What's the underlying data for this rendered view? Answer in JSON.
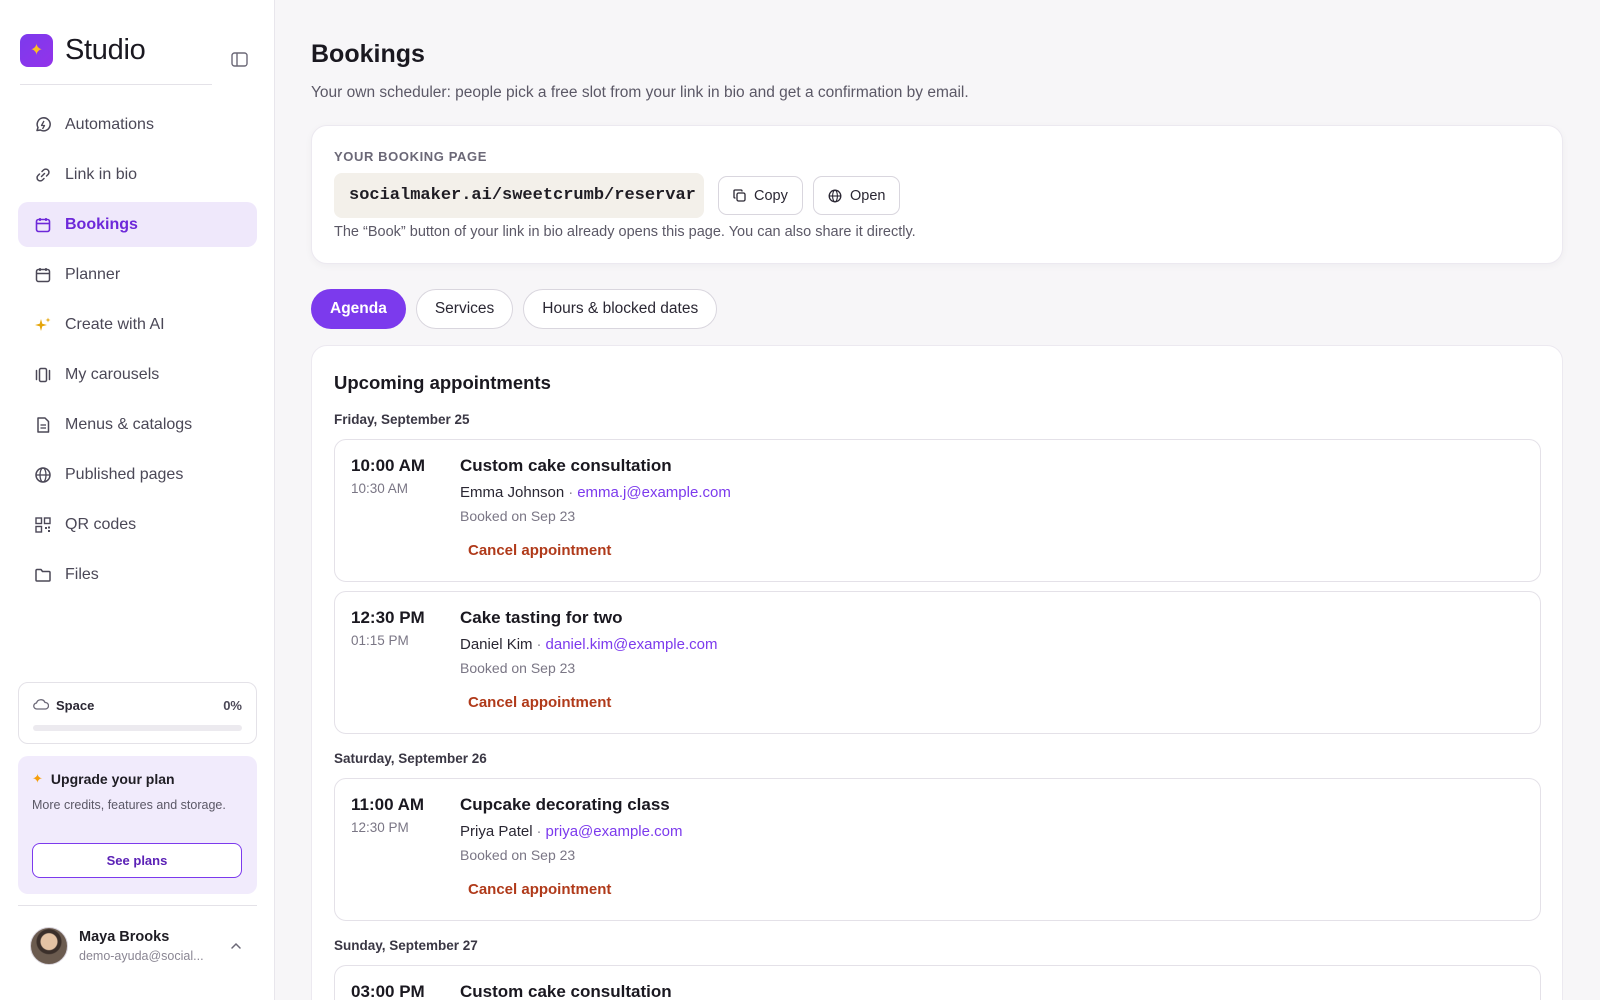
{
  "sidebar": {
    "brand": "Studio",
    "items": [
      {
        "label": "Automations",
        "icon": "automation-icon"
      },
      {
        "label": "Link in bio",
        "icon": "link-icon"
      },
      {
        "label": "Bookings",
        "icon": "calendar-icon",
        "active": true
      },
      {
        "label": "Planner",
        "icon": "calendar-icon"
      },
      {
        "label": "Create with AI",
        "icon": "sparkle-icon"
      },
      {
        "label": "My carousels",
        "icon": "carousel-icon"
      },
      {
        "label": "Menus & catalogs",
        "icon": "document-icon"
      },
      {
        "label": "Published pages",
        "icon": "globe-icon"
      },
      {
        "label": "QR codes",
        "icon": "qr-code-icon"
      },
      {
        "label": "Files",
        "icon": "folder-icon"
      }
    ],
    "space": {
      "label": "Space",
      "percent_text": "0%",
      "used_fraction": 0
    },
    "upgrade": {
      "title": "Upgrade your plan",
      "description": "More credits, features and storage.",
      "button": "See plans"
    },
    "user": {
      "name": "Maya Brooks",
      "email": "demo-ayuda@social..."
    }
  },
  "page": {
    "title": "Bookings",
    "subtitle": "Your own scheduler: people pick a free slot from your link in bio and get a confirmation by email."
  },
  "booking_page": {
    "label": "YOUR BOOKING PAGE",
    "url": "socialmaker.ai/sweetcrumb/reservar",
    "copy_label": "Copy",
    "open_label": "Open",
    "help": "The “Book” button of your link in bio already opens this page. You can also share it directly."
  },
  "tabs": [
    {
      "label": "Agenda",
      "active": true
    },
    {
      "label": "Services"
    },
    {
      "label": "Hours & blocked dates"
    }
  ],
  "agenda": {
    "title": "Upcoming appointments",
    "cancel_label": "Cancel appointment",
    "days": [
      {
        "date": "Friday, September 25",
        "appointments": [
          {
            "start": "10:00 AM",
            "end": "10:30 AM",
            "service": "Custom cake consultation",
            "client": "Emma Johnson",
            "separator": "·",
            "email": "emma.j@example.com",
            "booked": "Booked on Sep 23"
          },
          {
            "start": "12:30 PM",
            "end": "01:15 PM",
            "service": "Cake tasting for two",
            "client": "Daniel Kim",
            "separator": "·",
            "email": "daniel.kim@example.com",
            "booked": "Booked on Sep 23"
          }
        ]
      },
      {
        "date": "Saturday, September 26",
        "appointments": [
          {
            "start": "11:00 AM",
            "end": "12:30 PM",
            "service": "Cupcake decorating class",
            "client": "Priya Patel",
            "separator": "·",
            "email": "priya@example.com",
            "booked": "Booked on Sep 23"
          }
        ]
      },
      {
        "date": "Sunday, September 27",
        "appointments": [
          {
            "start": "03:00 PM",
            "service": "Custom cake consultation"
          }
        ]
      }
    ]
  },
  "colors": {
    "accent": "#7c3aed",
    "active_bg": "#efe8fb",
    "cancel": "#b03a1a"
  }
}
